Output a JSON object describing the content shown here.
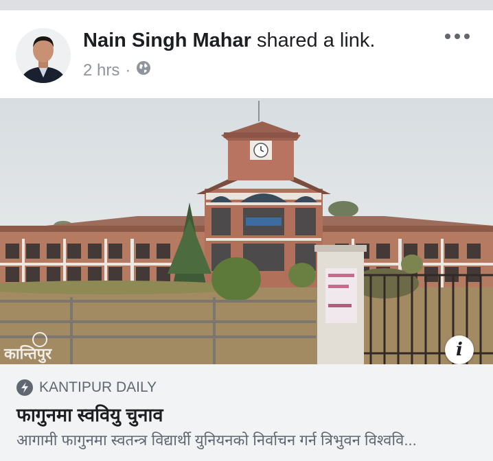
{
  "post": {
    "author": "Nain Singh Mahar",
    "action": "shared a link.",
    "time": "2 hrs",
    "separator": "·",
    "privacy_icon": "globe-icon",
    "more_icon": "more-options-icon"
  },
  "link": {
    "source": "KANTIPUR DAILY",
    "title": "फागुनमा स्ववियु चुनाव",
    "description": "आगामी फागुनमा स्वतन्त्र विद्यार्थी युनियनको निर्वाचन गर्न त्रिभुवन विश्ववि...",
    "info_label": "i",
    "watermark": "कान्तिपुर"
  },
  "colors": {
    "page_bg": "#dddfe2",
    "card_bg": "#ffffff",
    "link_bg": "#f2f3f5",
    "text_primary": "#1c1e21",
    "text_secondary": "#606770"
  }
}
